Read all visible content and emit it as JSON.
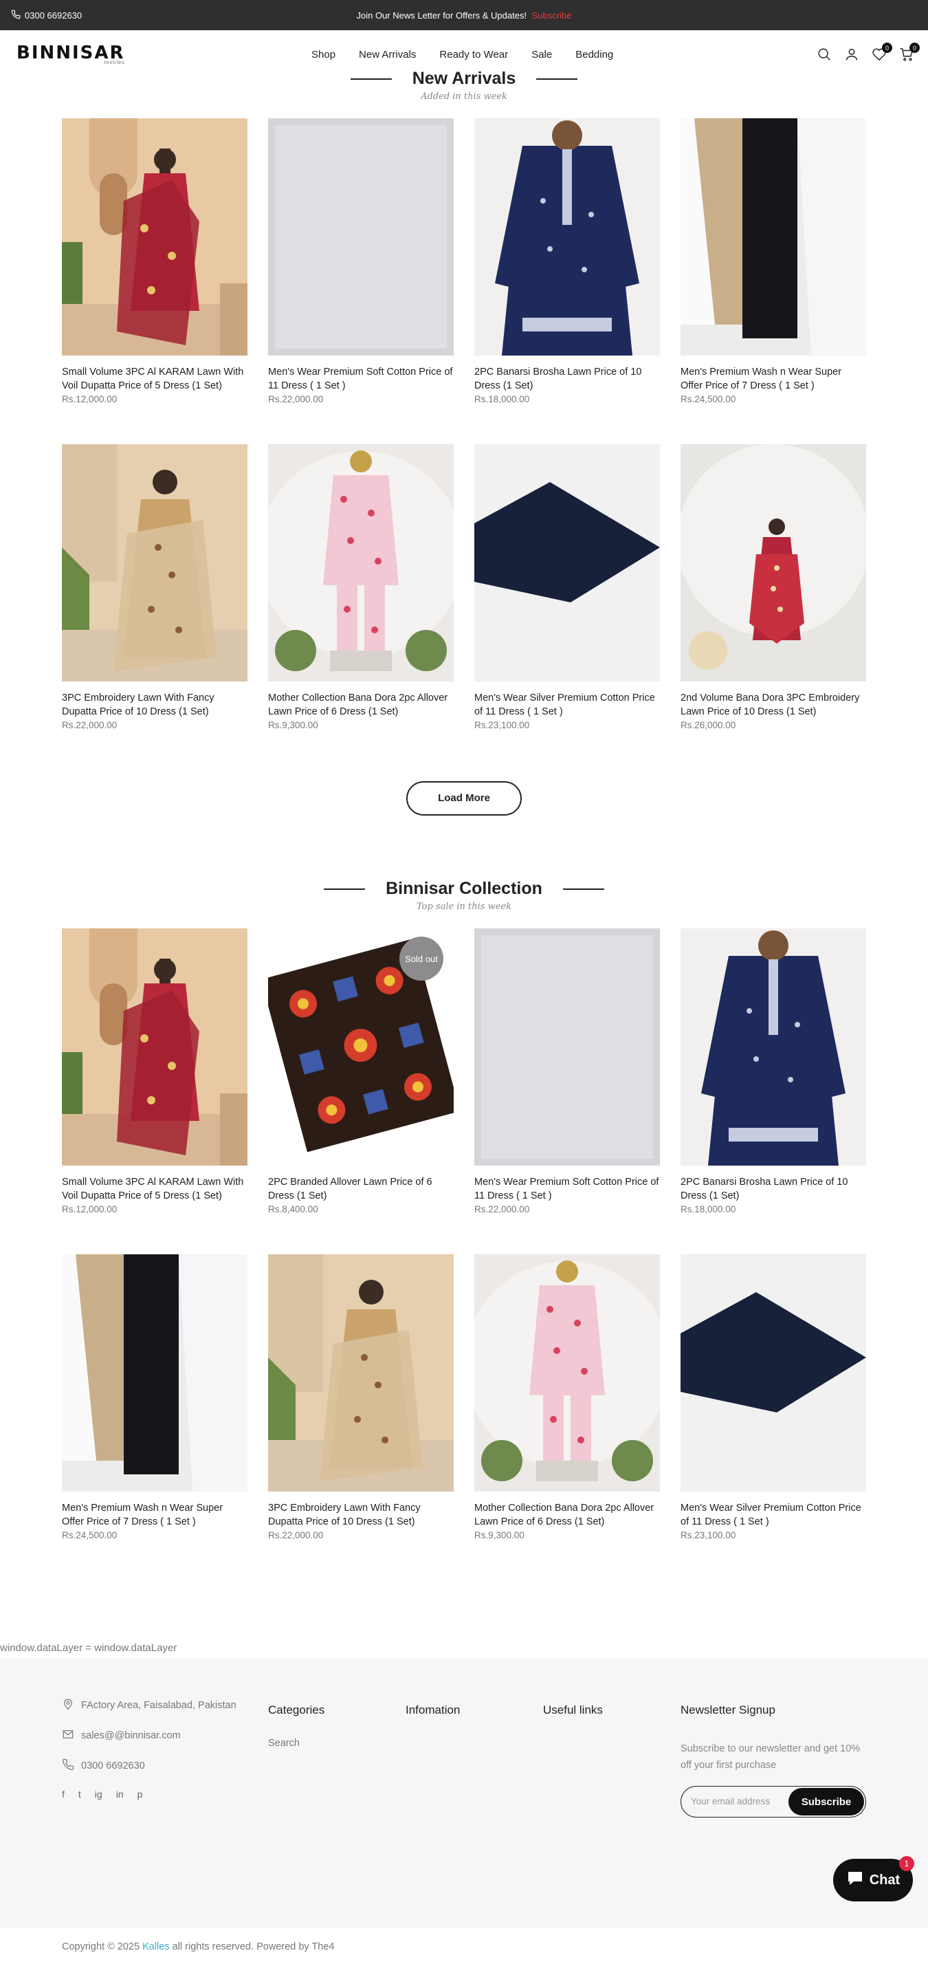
{
  "topbar": {
    "phone": "0300 6692630",
    "promo_text": "Join Our News Letter for Offers & Updates!",
    "promo_link": "Subscribe"
  },
  "header": {
    "logo": "BINNISAR",
    "logo_sub": "textiles",
    "nav": [
      "Shop",
      "New Arrivals",
      "Ready to Wear",
      "Sale",
      "Bedding"
    ],
    "wishlist_count": "0",
    "cart_count": "0"
  },
  "new_arrivals": {
    "title": "New Arrivals",
    "subtitle": "Added in this week",
    "load_more": "Load More",
    "products": [
      {
        "name": "Small Volume 3PC Al KARAM Lawn With Voil Dupatta Price of 5 Dress (1 Set)",
        "price": "Rs.12,000.00",
        "image": "red-printed-suit"
      },
      {
        "name": "Men's Wear Premium Soft Cotton Price of 11 Dress ( 1 Set )",
        "price": "Rs.22,000.00",
        "image": "white-fabric"
      },
      {
        "name": "2PC Banarsi Brosha Lawn Price of 10 Dress (1 Set)",
        "price": "Rs.18,000.00",
        "image": "navy-embroidered-kurta"
      },
      {
        "name": "Men's Premium Wash n Wear Super Offer Price of 7 Dress ( 1 Set )",
        "price": "Rs.24,500.00",
        "image": "beige-black-white-fabrics"
      },
      {
        "name": "3PC Embroidery Lawn With Fancy Dupatta Price of 10 Dress (1 Set)",
        "price": "Rs.22,000.00",
        "image": "beige-embroidered-suit"
      },
      {
        "name": "Mother Collection Bana Dora 2pc Allover Lawn Price of 6 Dress (1 Set)",
        "price": "Rs.9,300.00",
        "image": "floral-pink-suit"
      },
      {
        "name": "Men's Wear Silver Premium Cotton Price of 11 Dress ( 1 Set )",
        "price": "Rs.23,100.00",
        "image": "navy-fabric"
      },
      {
        "name": "2nd Volume Bana Dora 3PC Embroidery Lawn Price of 10 Dress (1 Set)",
        "price": "Rs.26,000.00",
        "image": "red-embroidered-suit"
      }
    ]
  },
  "collection": {
    "title": "Binnisar Collection",
    "subtitle": "Top sale in this week",
    "sold_out_label": "Sold out",
    "products": [
      {
        "name": "Small Volume 3PC Al KARAM Lawn With Voil Dupatta Price of 5 Dress (1 Set)",
        "price": "Rs.12,000.00",
        "image": "red-printed-suit"
      },
      {
        "name": "2PC Branded Allover Lawn Price of 6 Dress (1 Set)",
        "price": "Rs.8,400.00",
        "image": "folk-print-fabric",
        "sold_out": true
      },
      {
        "name": "Men's Wear Premium Soft Cotton Price of 11 Dress ( 1 Set )",
        "price": "Rs.22,000.00",
        "image": "white-fabric"
      },
      {
        "name": "2PC Banarsi Brosha Lawn Price of 10 Dress (1 Set)",
        "price": "Rs.18,000.00",
        "image": "navy-embroidered-kurta"
      },
      {
        "name": "Men's Premium Wash n Wear Super Offer Price of 7 Dress ( 1 Set )",
        "price": "Rs.24,500.00",
        "image": "beige-black-white-fabrics"
      },
      {
        "name": "3PC Embroidery Lawn With Fancy Dupatta Price of 10 Dress (1 Set)",
        "price": "Rs.22,000.00",
        "image": "beige-embroidered-suit"
      },
      {
        "name": "Mother Collection Bana Dora 2pc Allover Lawn Price of 6 Dress (1 Set)",
        "price": "Rs.9,300.00",
        "image": "floral-pink-suit"
      },
      {
        "name": "Men's Wear Silver Premium Cotton Price of 11 Dress ( 1 Set )",
        "price": "Rs.23,100.00",
        "image": "navy-fabric"
      }
    ]
  },
  "datalayer_text": "window.dataLayer = window.dataLayer",
  "footer": {
    "address": "FActory Area, Faisalabad, Pakistan",
    "email": "sales@@binnisar.com",
    "phone": "0300 6692630",
    "social": [
      "f",
      "t",
      "ig",
      "in",
      "p"
    ],
    "categories_title": "Categories",
    "categories_link": "Search",
    "information_title": "Infomation",
    "useful_title": "Useful links",
    "newsletter_title": "Newsletter Signup",
    "newsletter_text": "Subscribe to our newsletter and get 10% off your first purchase",
    "email_placeholder": "Your email address",
    "subscribe_label": "Subscribe",
    "copyright_prefix": "Copyright © 2025",
    "copyright_brand": "Kalles",
    "copyright_suffix": "all rights reserved. Powered by The4"
  },
  "chat": {
    "label": "Chat",
    "badge": "1"
  }
}
